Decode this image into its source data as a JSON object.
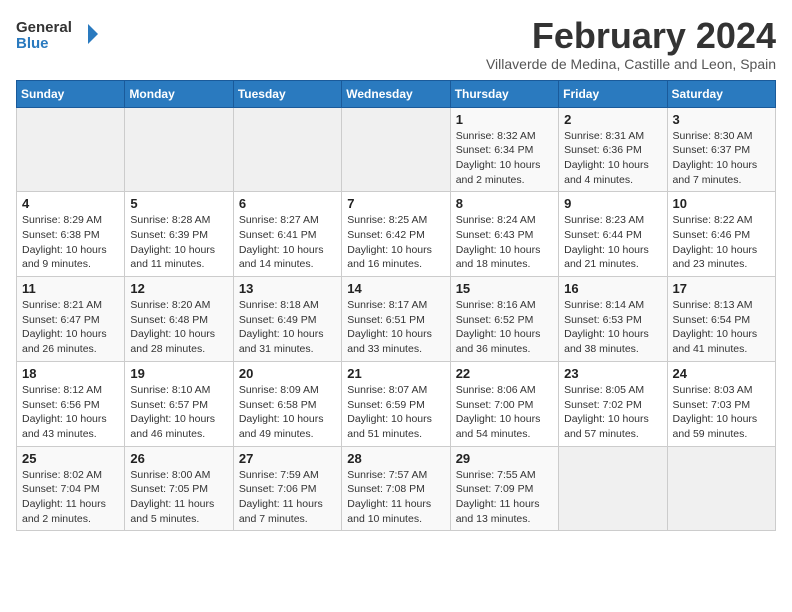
{
  "logo": {
    "line1": "General",
    "line2": "Blue"
  },
  "header": {
    "month_title": "February 2024",
    "subtitle": "Villaverde de Medina, Castille and Leon, Spain"
  },
  "weekdays": [
    "Sunday",
    "Monday",
    "Tuesday",
    "Wednesday",
    "Thursday",
    "Friday",
    "Saturday"
  ],
  "weeks": [
    [
      {
        "day": "",
        "info": ""
      },
      {
        "day": "",
        "info": ""
      },
      {
        "day": "",
        "info": ""
      },
      {
        "day": "",
        "info": ""
      },
      {
        "day": "1",
        "info": "Sunrise: 8:32 AM\nSunset: 6:34 PM\nDaylight: 10 hours\nand 2 minutes."
      },
      {
        "day": "2",
        "info": "Sunrise: 8:31 AM\nSunset: 6:36 PM\nDaylight: 10 hours\nand 4 minutes."
      },
      {
        "day": "3",
        "info": "Sunrise: 8:30 AM\nSunset: 6:37 PM\nDaylight: 10 hours\nand 7 minutes."
      }
    ],
    [
      {
        "day": "4",
        "info": "Sunrise: 8:29 AM\nSunset: 6:38 PM\nDaylight: 10 hours\nand 9 minutes."
      },
      {
        "day": "5",
        "info": "Sunrise: 8:28 AM\nSunset: 6:39 PM\nDaylight: 10 hours\nand 11 minutes."
      },
      {
        "day": "6",
        "info": "Sunrise: 8:27 AM\nSunset: 6:41 PM\nDaylight: 10 hours\nand 14 minutes."
      },
      {
        "day": "7",
        "info": "Sunrise: 8:25 AM\nSunset: 6:42 PM\nDaylight: 10 hours\nand 16 minutes."
      },
      {
        "day": "8",
        "info": "Sunrise: 8:24 AM\nSunset: 6:43 PM\nDaylight: 10 hours\nand 18 minutes."
      },
      {
        "day": "9",
        "info": "Sunrise: 8:23 AM\nSunset: 6:44 PM\nDaylight: 10 hours\nand 21 minutes."
      },
      {
        "day": "10",
        "info": "Sunrise: 8:22 AM\nSunset: 6:46 PM\nDaylight: 10 hours\nand 23 minutes."
      }
    ],
    [
      {
        "day": "11",
        "info": "Sunrise: 8:21 AM\nSunset: 6:47 PM\nDaylight: 10 hours\nand 26 minutes."
      },
      {
        "day": "12",
        "info": "Sunrise: 8:20 AM\nSunset: 6:48 PM\nDaylight: 10 hours\nand 28 minutes."
      },
      {
        "day": "13",
        "info": "Sunrise: 8:18 AM\nSunset: 6:49 PM\nDaylight: 10 hours\nand 31 minutes."
      },
      {
        "day": "14",
        "info": "Sunrise: 8:17 AM\nSunset: 6:51 PM\nDaylight: 10 hours\nand 33 minutes."
      },
      {
        "day": "15",
        "info": "Sunrise: 8:16 AM\nSunset: 6:52 PM\nDaylight: 10 hours\nand 36 minutes."
      },
      {
        "day": "16",
        "info": "Sunrise: 8:14 AM\nSunset: 6:53 PM\nDaylight: 10 hours\nand 38 minutes."
      },
      {
        "day": "17",
        "info": "Sunrise: 8:13 AM\nSunset: 6:54 PM\nDaylight: 10 hours\nand 41 minutes."
      }
    ],
    [
      {
        "day": "18",
        "info": "Sunrise: 8:12 AM\nSunset: 6:56 PM\nDaylight: 10 hours\nand 43 minutes."
      },
      {
        "day": "19",
        "info": "Sunrise: 8:10 AM\nSunset: 6:57 PM\nDaylight: 10 hours\nand 46 minutes."
      },
      {
        "day": "20",
        "info": "Sunrise: 8:09 AM\nSunset: 6:58 PM\nDaylight: 10 hours\nand 49 minutes."
      },
      {
        "day": "21",
        "info": "Sunrise: 8:07 AM\nSunset: 6:59 PM\nDaylight: 10 hours\nand 51 minutes."
      },
      {
        "day": "22",
        "info": "Sunrise: 8:06 AM\nSunset: 7:00 PM\nDaylight: 10 hours\nand 54 minutes."
      },
      {
        "day": "23",
        "info": "Sunrise: 8:05 AM\nSunset: 7:02 PM\nDaylight: 10 hours\nand 57 minutes."
      },
      {
        "day": "24",
        "info": "Sunrise: 8:03 AM\nSunset: 7:03 PM\nDaylight: 10 hours\nand 59 minutes."
      }
    ],
    [
      {
        "day": "25",
        "info": "Sunrise: 8:02 AM\nSunset: 7:04 PM\nDaylight: 11 hours\nand 2 minutes."
      },
      {
        "day": "26",
        "info": "Sunrise: 8:00 AM\nSunset: 7:05 PM\nDaylight: 11 hours\nand 5 minutes."
      },
      {
        "day": "27",
        "info": "Sunrise: 7:59 AM\nSunset: 7:06 PM\nDaylight: 11 hours\nand 7 minutes."
      },
      {
        "day": "28",
        "info": "Sunrise: 7:57 AM\nSunset: 7:08 PM\nDaylight: 11 hours\nand 10 minutes."
      },
      {
        "day": "29",
        "info": "Sunrise: 7:55 AM\nSunset: 7:09 PM\nDaylight: 11 hours\nand 13 minutes."
      },
      {
        "day": "",
        "info": ""
      },
      {
        "day": "",
        "info": ""
      }
    ]
  ]
}
